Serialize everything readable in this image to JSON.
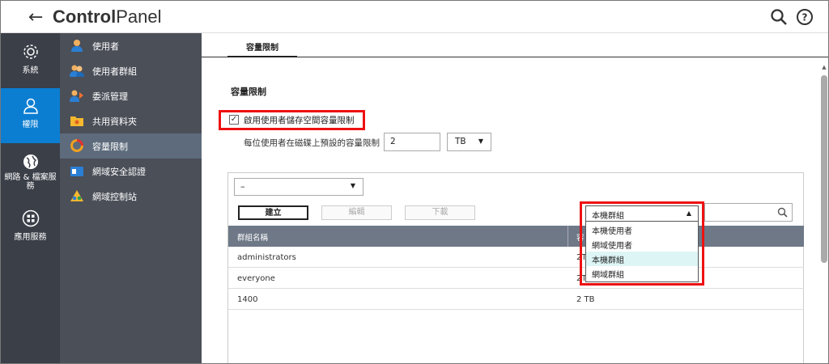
{
  "header": {
    "title_bold": "Control",
    "title_light": "Panel"
  },
  "rail": {
    "items": [
      {
        "label": "系統",
        "icon": "gear-icon"
      },
      {
        "label": "權限",
        "icon": "user-icon",
        "active": true
      },
      {
        "label": "網路 & 檔案服務",
        "icon": "globe-icon"
      },
      {
        "label": "應用服務",
        "icon": "grid-icon"
      }
    ]
  },
  "submenu": {
    "items": [
      {
        "label": "使用者",
        "icon": "user-icon"
      },
      {
        "label": "使用者群組",
        "icon": "user-group-icon"
      },
      {
        "label": "委派管理",
        "icon": "delegate-icon"
      },
      {
        "label": "共用資料夾",
        "icon": "folder-share-icon"
      },
      {
        "label": "容量限制",
        "icon": "quota-pie-icon",
        "active": true
      },
      {
        "label": "網域安全認證",
        "icon": "domain-security-icon"
      },
      {
        "label": "網域控制站",
        "icon": "domain-controller-icon"
      }
    ]
  },
  "main": {
    "tab": "容量限制",
    "section_title": "容量限制",
    "enable_label": "啟用使用者儲存空間容量限制",
    "enable_checked": true,
    "default_label": "每位使用者在磁碟上預設的容量限制",
    "default_value": "2",
    "unit": "TB",
    "filter_value": "–",
    "buttons": {
      "create": "建立",
      "edit": "編輯",
      "download": "下載"
    },
    "table": {
      "headers": [
        "群組名稱",
        "容"
      ],
      "rows": [
        [
          "administrators",
          "2T"
        ],
        [
          "everyone",
          "2T"
        ],
        [
          "1400",
          "2 TB"
        ]
      ]
    },
    "dropdown": {
      "selected": "本機群組",
      "options": [
        "本機使用者",
        "網域使用者",
        "本機群組",
        "網域群組"
      ],
      "highlighted_index": 2
    }
  },
  "colors": {
    "rail_bg": "#3b3f48",
    "submenu_bg": "#4b4f58",
    "active_blue": "#0b7ed2",
    "highlight_red": "#e11111"
  }
}
